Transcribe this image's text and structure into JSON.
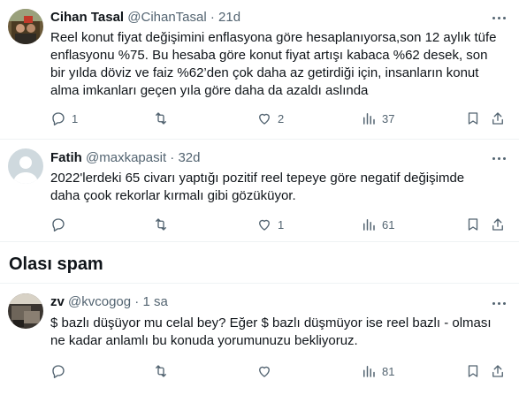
{
  "tweets": [
    {
      "name": "Cihan Tasal",
      "handle": "@CihanTasal",
      "sep": "·",
      "time": "21d",
      "text": "Reel konut fiyat değişimini enflasyona göre hesaplanıyorsa,son 12 aylık tüfe\nenflasyonu %75.  Bu hesaba göre konut fiyat artışı kabaca %62 desek, son\nbir yılda döviz ve faiz %62’den çok daha az getirdiği için, insanların konut\nalma imkanları geçen yıla göre daha da azaldı aslında",
      "replies": "1",
      "retweets": "",
      "likes": "2",
      "views": "37"
    },
    {
      "name": "Fatih",
      "handle": "@maxkapasit",
      "sep": "·",
      "time": "32d",
      "text": "2022'lerdeki 65 civarı yaptığı pozitif reel tepeye göre negatif değişimde\ndaha çook rekorlar kırmalı gibi gözüküyor.",
      "replies": "",
      "retweets": "",
      "likes": "1",
      "views": "61"
    },
    {
      "name": "zv",
      "handle": "@kvcogog",
      "sep": "·",
      "time": "1 sa",
      "text": "$ bazlı düşüyor mu celal bey? Eğer $ bazlı düşmüyor ise reel bazlı - olması\nne kadar anlamlı bu konuda yorumunuzu bekliyoruz.",
      "replies": "",
      "retweets": "",
      "likes": "",
      "views": "81"
    }
  ],
  "section_title": "Olası spam",
  "icons": [
    "more-icon",
    "reply-icon",
    "retweet-icon",
    "like-icon",
    "views-icon",
    "bookmark-icon",
    "share-icon"
  ],
  "colors": {
    "text": "#0f1419",
    "muted": "#536471",
    "divider": "#eff3f4"
  }
}
